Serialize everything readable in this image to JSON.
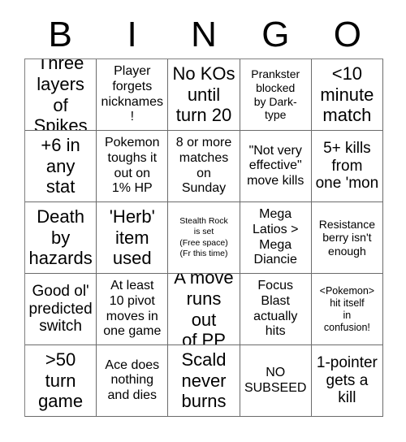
{
  "card": {
    "header_letters": [
      "B",
      "I",
      "N",
      "G",
      "O"
    ],
    "free_space_index": 12,
    "colors": {
      "background": "#ffffff",
      "text": "#000000",
      "grid_line": "#6b6b6b"
    },
    "cells": [
      {
        "text": "Three\nlayers of\nSpikes",
        "size": "size-xl"
      },
      {
        "text": "Player\nforgets\nnicknames!",
        "size": "size-md"
      },
      {
        "text": "No KOs\nuntil\nturn 20",
        "size": "size-xl"
      },
      {
        "text": "Prankster\nblocked\nby Dark-\ntype",
        "size": "size-sm"
      },
      {
        "text": "<10\nminute\nmatch",
        "size": "size-xl"
      },
      {
        "text": "+6 in\nany\nstat",
        "size": "size-xl"
      },
      {
        "text": "Pokemon\ntoughs it\nout on\n1% HP",
        "size": "size-md"
      },
      {
        "text": "8 or more\nmatches\non\nSunday",
        "size": "size-md"
      },
      {
        "text": "\"Not very\neffective\"\nmove kills",
        "size": "size-md"
      },
      {
        "text": "5+ kills\nfrom\none 'mon",
        "size": "size-lg"
      },
      {
        "text": "Death\nby\nhazards",
        "size": "size-xl"
      },
      {
        "text": "'Herb'\nitem\nused",
        "size": "size-xl"
      },
      {
        "text": "Stealth Rock\nis set\n(Free space)\n(Fr this time)",
        "size": "size-xxs"
      },
      {
        "text": "Mega\nLatios >\nMega\nDiancie",
        "size": "size-md"
      },
      {
        "text": "Resistance\nberry isn't\nenough",
        "size": "size-sm"
      },
      {
        "text": "Good ol'\npredicted\nswitch",
        "size": "size-lg"
      },
      {
        "text": "At least\n10 pivot\nmoves in\none game",
        "size": "size-md"
      },
      {
        "text": "A move\nruns out\nof PP",
        "size": "size-xl"
      },
      {
        "text": "Focus\nBlast\nactually\nhits",
        "size": "size-md"
      },
      {
        "text": "<Pokemon>\nhit itself\nin\nconfusion!",
        "size": "size-xs"
      },
      {
        "text": ">50\nturn\ngame",
        "size": "size-xl"
      },
      {
        "text": "Ace does\nnothing\nand dies",
        "size": "size-md"
      },
      {
        "text": "Scald\nnever\nburns",
        "size": "size-xl"
      },
      {
        "text": "NO\nSUBSEED",
        "size": "size-md"
      },
      {
        "text": "1-pointer\ngets a\nkill",
        "size": "size-lg"
      }
    ]
  }
}
